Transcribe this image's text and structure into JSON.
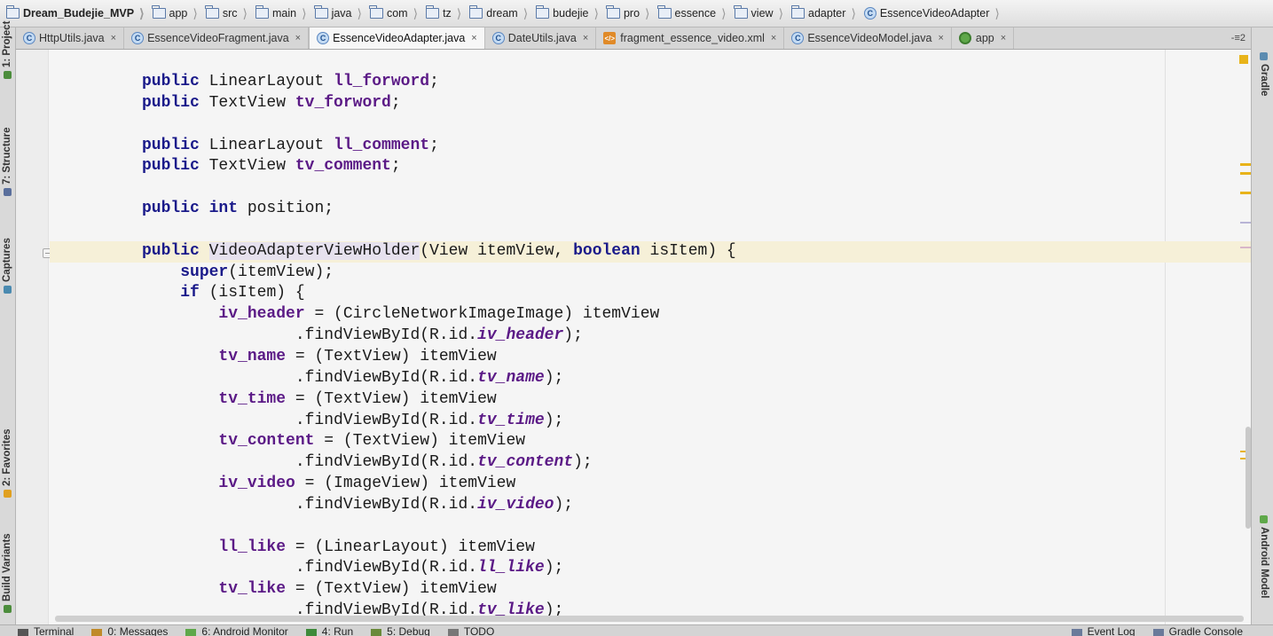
{
  "breadcrumb": [
    {
      "label": "Dream_Budejie_MVP",
      "icon": "project-folder-icon"
    },
    {
      "label": "app",
      "icon": "module-folder-icon"
    },
    {
      "label": "src",
      "icon": "folder-icon"
    },
    {
      "label": "main",
      "icon": "folder-icon"
    },
    {
      "label": "java",
      "icon": "source-folder-icon"
    },
    {
      "label": "com",
      "icon": "package-icon"
    },
    {
      "label": "tz",
      "icon": "package-icon"
    },
    {
      "label": "dream",
      "icon": "package-icon"
    },
    {
      "label": "budejie",
      "icon": "package-icon"
    },
    {
      "label": "pro",
      "icon": "package-icon"
    },
    {
      "label": "essence",
      "icon": "package-icon"
    },
    {
      "label": "view",
      "icon": "package-icon"
    },
    {
      "label": "adapter",
      "icon": "package-icon"
    },
    {
      "label": "EssenceVideoAdapter",
      "icon": "class-icon"
    }
  ],
  "tabs": [
    {
      "label": "HttpUtils.java",
      "close": "×",
      "icon": "class-icon",
      "active": false
    },
    {
      "label": "EssenceVideoFragment.java",
      "close": "×",
      "icon": "class-icon",
      "active": false
    },
    {
      "label": "EssenceVideoAdapter.java",
      "close": "×",
      "icon": "class-icon",
      "active": true
    },
    {
      "label": "DateUtils.java",
      "close": "×",
      "icon": "class-icon",
      "active": false
    },
    {
      "label": "fragment_essence_video.xml",
      "close": "×",
      "icon": "xml-file-icon",
      "active": false
    },
    {
      "label": "EssenceVideoModel.java",
      "close": "×",
      "icon": "class-icon",
      "active": false
    },
    {
      "label": "app",
      "close": "×",
      "icon": "android-app-icon",
      "active": false
    }
  ],
  "tab_overflow": "-≡2",
  "left_tools": [
    {
      "label": "1: Project",
      "icon": "project-icon"
    },
    {
      "label": "7: Structure",
      "icon": "structure-icon"
    },
    {
      "label": "Captures",
      "icon": "captures-icon"
    },
    {
      "label": "2: Favorites",
      "icon": "star-icon"
    },
    {
      "label": "Build Variants",
      "icon": "build-variants-icon"
    }
  ],
  "right_tools": [
    {
      "label": "Gradle",
      "icon": "gradle-icon"
    },
    {
      "label": "Android Model",
      "icon": "android-icon"
    }
  ],
  "code_lines": [
    [
      {
        "t": "public",
        "c": "kw"
      },
      {
        "t": " LinearLayout "
      },
      {
        "t": "ll_forword",
        "c": "fld"
      },
      {
        "t": ";"
      }
    ],
    [
      {
        "t": "public",
        "c": "kw"
      },
      {
        "t": " TextView "
      },
      {
        "t": "tv_forword",
        "c": "fld"
      },
      {
        "t": ";"
      }
    ],
    [],
    [
      {
        "t": "public",
        "c": "kw"
      },
      {
        "t": " LinearLayout "
      },
      {
        "t": "ll_comment",
        "c": "fld"
      },
      {
        "t": ";"
      }
    ],
    [
      {
        "t": "public",
        "c": "kw"
      },
      {
        "t": " TextView "
      },
      {
        "t": "tv_comment",
        "c": "fld"
      },
      {
        "t": ";"
      }
    ],
    [],
    [
      {
        "t": "public int",
        "c": "kw"
      },
      {
        "t": " position;"
      }
    ],
    [],
    [
      {
        "t": "public",
        "c": "kw"
      },
      {
        "t": " "
      },
      {
        "t": "VideoAdapterViewHolder",
        "c": "id-hl"
      },
      {
        "t": "(View itemView, "
      },
      {
        "t": "boolean",
        "c": "kw"
      },
      {
        "t": " isItem) {"
      }
    ],
    [
      {
        "t": "    "
      },
      {
        "t": "super",
        "c": "kw"
      },
      {
        "t": "(itemView);"
      }
    ],
    [
      {
        "t": "    "
      },
      {
        "t": "if",
        "c": "kw"
      },
      {
        "t": " (isItem) {"
      }
    ],
    [
      {
        "t": "        "
      },
      {
        "t": "iv_header",
        "c": "fld"
      },
      {
        "t": " = (CircleNetworkImageImage) itemView"
      }
    ],
    [
      {
        "t": "                .findViewById(R.id."
      },
      {
        "t": "iv_header",
        "c": "fld-it"
      },
      {
        "t": ");"
      }
    ],
    [
      {
        "t": "        "
      },
      {
        "t": "tv_name",
        "c": "fld"
      },
      {
        "t": " = (TextView) itemView"
      }
    ],
    [
      {
        "t": "                .findViewById(R.id."
      },
      {
        "t": "tv_name",
        "c": "fld-it"
      },
      {
        "t": ");"
      }
    ],
    [
      {
        "t": "        "
      },
      {
        "t": "tv_time",
        "c": "fld"
      },
      {
        "t": " = (TextView) itemView"
      }
    ],
    [
      {
        "t": "                .findViewById(R.id."
      },
      {
        "t": "tv_time",
        "c": "fld-it"
      },
      {
        "t": ");"
      }
    ],
    [
      {
        "t": "        "
      },
      {
        "t": "tv_content",
        "c": "fld"
      },
      {
        "t": " = (TextView) itemView"
      }
    ],
    [
      {
        "t": "                .findViewById(R.id."
      },
      {
        "t": "tv_content",
        "c": "fld-it"
      },
      {
        "t": ");"
      }
    ],
    [
      {
        "t": "        "
      },
      {
        "t": "iv_video",
        "c": "fld"
      },
      {
        "t": " = (ImageView) itemView"
      }
    ],
    [
      {
        "t": "                .findViewById(R.id."
      },
      {
        "t": "iv_video",
        "c": "fld-it"
      },
      {
        "t": ");"
      }
    ],
    [],
    [
      {
        "t": "        "
      },
      {
        "t": "ll_like",
        "c": "fld"
      },
      {
        "t": " = (LinearLayout) itemView"
      }
    ],
    [
      {
        "t": "                .findViewById(R.id."
      },
      {
        "t": "ll_like",
        "c": "fld-it"
      },
      {
        "t": ");"
      }
    ],
    [
      {
        "t": "        "
      },
      {
        "t": "tv_like",
        "c": "fld"
      },
      {
        "t": " = (TextView) itemView"
      }
    ],
    [
      {
        "t": "                .findViewById(R.id."
      },
      {
        "t": "tv_like",
        "c": "fld-it"
      },
      {
        "t": ");"
      }
    ]
  ],
  "current_line": 8,
  "bottom_tools": [
    {
      "label": "Terminal",
      "icon": "terminal-icon"
    },
    {
      "label": "0: Messages",
      "icon": "messages-icon"
    },
    {
      "label": "6: Android Monitor",
      "icon": "android-monitor-icon"
    },
    {
      "label": "4: Run",
      "icon": "run-icon"
    },
    {
      "label": "5: Debug",
      "icon": "debug-icon"
    },
    {
      "label": "TODO",
      "icon": "todo-icon"
    }
  ],
  "bottom_tools_right": [
    {
      "label": "Event Log",
      "icon": "event-log-icon"
    },
    {
      "label": "Gradle Console",
      "icon": "gradle-console-icon"
    }
  ],
  "colors": {
    "keyword": "#1a1a8a",
    "field": "#5b1a86",
    "current_line_bg": "#f6f0d8",
    "warning_mark": "#e8b31a"
  }
}
